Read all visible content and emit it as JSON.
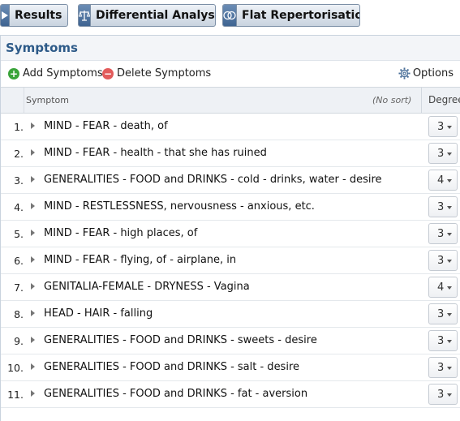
{
  "toolbar": {
    "results_label": "Results",
    "differential_label": "Differential Analysis",
    "flat_label": "Flat Repertorisation"
  },
  "panel": {
    "title": "Symptoms",
    "add_label": "Add Symptoms",
    "delete_label": "Delete Symptoms",
    "options_label": "Options"
  },
  "table": {
    "symptom_header": "Symptom",
    "sort_hint": "(No sort)",
    "degree_header": "Degree",
    "rows": [
      {
        "num": "1.",
        "text": "MIND - FEAR - death, of",
        "degree": "3"
      },
      {
        "num": "2.",
        "text": "MIND - FEAR - health - that she has ruined",
        "degree": "3"
      },
      {
        "num": "3.",
        "text": "GENERALITIES - FOOD and DRINKS - cold - drinks, water - desire",
        "degree": "4"
      },
      {
        "num": "4.",
        "text": "MIND - RESTLESSNESS, nervousness - anxious, etc.",
        "degree": "3"
      },
      {
        "num": "5.",
        "text": "MIND - FEAR - high places, of",
        "degree": "3"
      },
      {
        "num": "6.",
        "text": "MIND - FEAR - flying, of - airplane, in",
        "degree": "3"
      },
      {
        "num": "7.",
        "text": "GENITALIA-FEMALE - DRYNESS - Vagina",
        "degree": "4"
      },
      {
        "num": "8.",
        "text": "HEAD - HAIR - falling",
        "degree": "3"
      },
      {
        "num": "9.",
        "text": "GENERALITIES - FOOD and DRINKS - sweets - desire",
        "degree": "3"
      },
      {
        "num": "10.",
        "text": "GENERALITIES - FOOD and DRINKS - salt - desire",
        "degree": "3"
      },
      {
        "num": "11.",
        "text": "GENERALITIES - FOOD and DRINKS - fat - aversion",
        "degree": "3"
      }
    ]
  }
}
